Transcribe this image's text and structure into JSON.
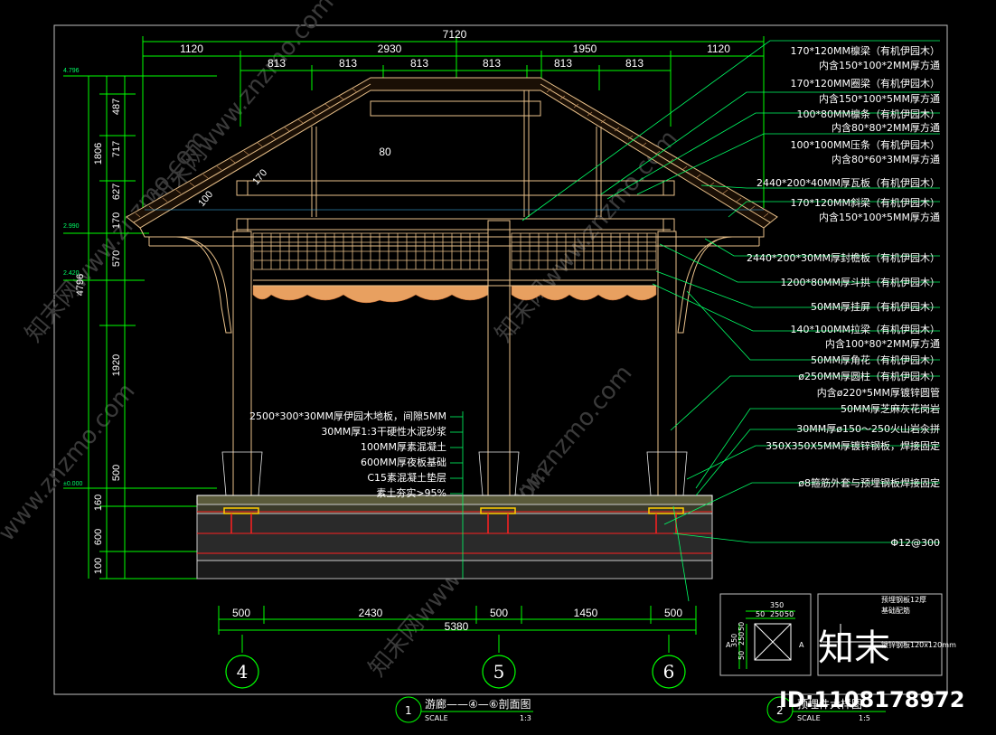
{
  "colors": {
    "background": "#000000",
    "dimension_line": "#00ff00",
    "structure": "#e8c08a",
    "timber": "#c8905a",
    "leader": "#00ff66",
    "rebar": "#ff2020",
    "ground": "#909090",
    "column_base": "#ffcc00"
  },
  "top_dims": {
    "total": "7120",
    "seg1": [
      "1120",
      "2930",
      "1950",
      "1120"
    ],
    "seg2": [
      "813",
      "813",
      "813",
      "813",
      "813",
      "813"
    ]
  },
  "left_dims": {
    "outer": [
      "1806",
      "4796"
    ],
    "inner": [
      "487",
      "717",
      "170",
      "627",
      "570",
      "1920",
      "500",
      "160",
      "600",
      "100"
    ],
    "elevations": [
      "4.796",
      "2.990",
      "2.420",
      "±0.000"
    ]
  },
  "bottom_dims": {
    "segments": [
      "500",
      "2430",
      "500",
      "1450",
      "500"
    ],
    "total": "5380"
  },
  "annotations_right": [
    "170*120MM檩梁（有机伊园木）",
    "内含150*100*2MM厚方通",
    "170*120MM圈梁（有机伊园木）",
    "内含150*100*5MM厚方通",
    "100*80MM檩条（有机伊园木）",
    "内含80*80*2MM厚方通",
    "100*100MM压条（有机伊园木）",
    "内含80*60*3MM厚方通",
    "2440*200*40MM厚瓦板（有机伊园木）",
    "170*120MM斜梁（有机伊园木）",
    "内含150*100*5MM厚方通",
    "2440*200*30MM厚封檐板（有机伊园木）",
    "1200*80MM厚斗拱（有机伊园木）",
    "50MM厚挂屏（有机伊园木）",
    "140*100MM拉梁（有机伊园木）",
    "内含100*80*2MM厚方通",
    "50MM厚角花（有机伊园木）",
    "ø250MM厚圆柱（有机伊园木）",
    "内含ø220*5MM厚镀锌圆管",
    "50MM厚芝麻灰花岗岩",
    "30MM厚ø150～250火山岩汆拼",
    "350X350X5MM厚镀锌钢板，焊接固定",
    "ø8箍筋外套与预埋钢板焊接固定",
    "Φ12@300"
  ],
  "annotations_center": [
    "2500*300*30MM厚伊园木地板，间隙5MM",
    "30MM厚1:3干硬性水泥砂浆",
    "100MM厚素混凝土",
    "600MM厚夜板基础",
    "C15素混凝土垫层",
    "素土夯实>95%"
  ],
  "roof_marks": [
    "80",
    "170",
    "100"
  ],
  "axes": [
    "4",
    "5",
    "6"
  ],
  "detail": {
    "dims_top": [
      "350",
      "50",
      "250",
      "50"
    ],
    "dims_left": [
      "50",
      "250",
      "50",
      "350"
    ],
    "section_marks": [
      "A",
      "A"
    ],
    "notes": [
      "预埋钢板12厚",
      "基础配筋",
      "镀锌钢板120x120mm"
    ]
  },
  "title1": {
    "number": "1",
    "text": "游廊——④—⑥剖面图",
    "scale_label": "SCALE",
    "scale": "1:3"
  },
  "title2": {
    "number": "2",
    "text": "预埋件大样图",
    "scale_label": "SCALE",
    "scale": "1:5"
  },
  "watermarks": [
    "知末网www.znzmo.com",
    "知末网www.znzmo.com",
    "知末网www.znzmo.com",
    "www.znzmo.com",
    "www.znzmo.com",
    "知末网www.znzmo.com"
  ],
  "logo": "知末",
  "id_label": "ID:1108178972"
}
